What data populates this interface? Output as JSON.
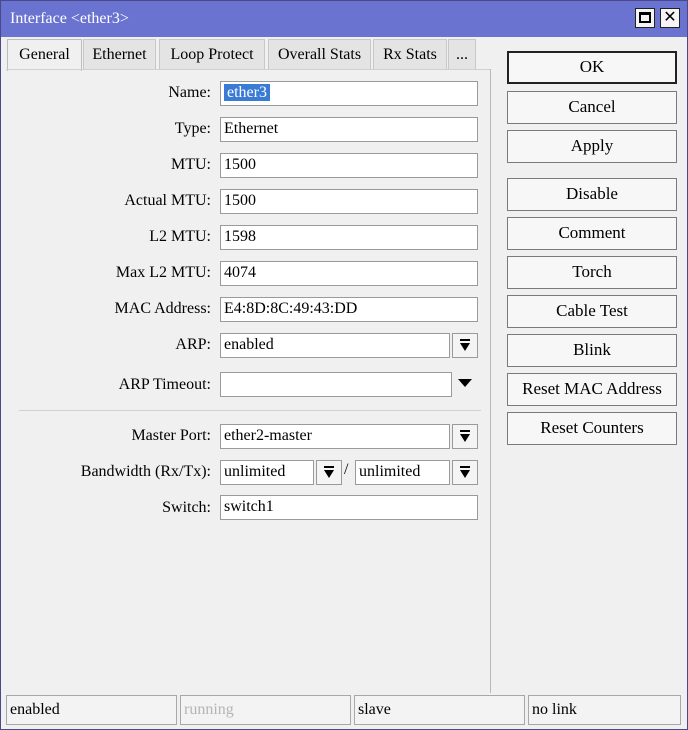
{
  "window": {
    "title": "Interface <ether3>"
  },
  "tabs": [
    {
      "label": "General",
      "active": true
    },
    {
      "label": "Ethernet"
    },
    {
      "label": "Loop Protect"
    },
    {
      "label": "Overall Stats"
    },
    {
      "label": "Rx Stats"
    },
    {
      "label": "..."
    }
  ],
  "form": {
    "name": {
      "label": "Name:",
      "value": "ether3"
    },
    "type": {
      "label": "Type:",
      "value": "Ethernet"
    },
    "mtu": {
      "label": "MTU:",
      "value": "1500"
    },
    "actual_mtu": {
      "label": "Actual MTU:",
      "value": "1500"
    },
    "l2_mtu": {
      "label": "L2 MTU:",
      "value": "1598"
    },
    "max_l2_mtu": {
      "label": "Max L2 MTU:",
      "value": "4074"
    },
    "mac_address": {
      "label": "MAC Address:",
      "value": "E4:8D:8C:49:43:DD"
    },
    "arp": {
      "label": "ARP:",
      "value": "enabled"
    },
    "arp_timeout": {
      "label": "ARP Timeout:",
      "value": ""
    },
    "master_port": {
      "label": "Master Port:",
      "value": "ether2-master"
    },
    "bandwidth": {
      "label": "Bandwidth (Rx/Tx):",
      "rx": "unlimited",
      "separator": "/",
      "tx": "unlimited"
    },
    "switch": {
      "label": "Switch:",
      "value": "switch1"
    }
  },
  "buttons": {
    "ok": "OK",
    "cancel": "Cancel",
    "apply": "Apply",
    "disable": "Disable",
    "comment": "Comment",
    "torch": "Torch",
    "cable_test": "Cable Test",
    "blink": "Blink",
    "reset_mac": "Reset MAC Address",
    "reset_counters": "Reset Counters"
  },
  "statusbar": {
    "state": "enabled",
    "running": "running",
    "role": "slave",
    "link": "no link"
  },
  "colors": {
    "titlebar": "#6a73cf",
    "selection": "#3a7bd5"
  }
}
